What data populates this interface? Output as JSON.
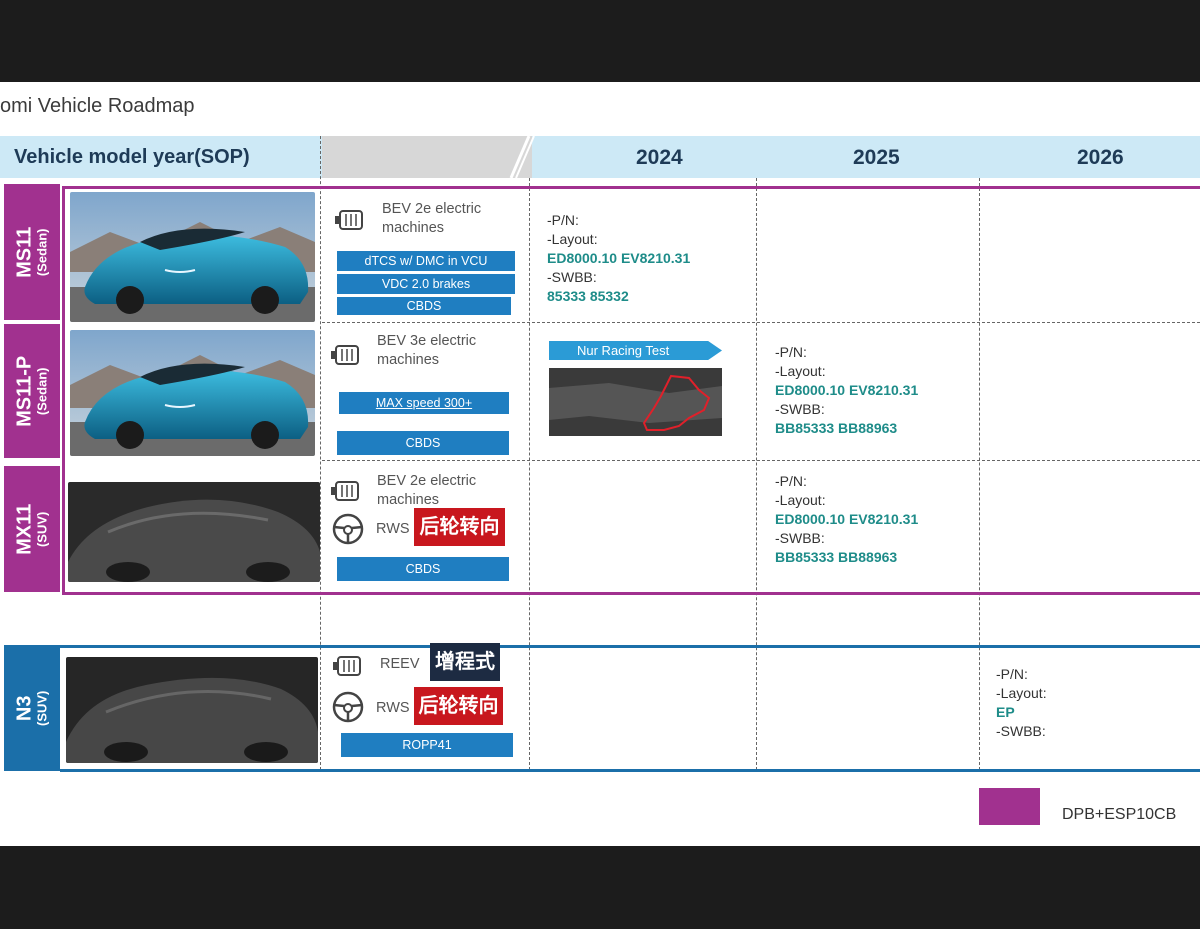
{
  "title": "omi Vehicle Roadmap",
  "header": {
    "label": "Vehicle model year(SOP)",
    "years": [
      "2024",
      "2025",
      "2026"
    ]
  },
  "rows": [
    {
      "name": "MS11",
      "type": "(Sedan)",
      "powertrain": "BEV 2e electric machines",
      "boxes": [
        "dTCS w/ DMC in VCU",
        "VDC 2.0 brakes",
        "CBDS"
      ],
      "info": {
        "pn": "-P/N:",
        "layout": "-Layout:",
        "layout_val": "ED8000.10  EV8210.31",
        "swbb": "-SWBB:",
        "swbb_val": "85333  85332"
      }
    },
    {
      "name": "MS11-P",
      "type": "(Sedan)",
      "powertrain": "BEV 3e electric machines",
      "boxes": [
        "MAX speed 300+",
        "CBDS"
      ],
      "racing": "Nur Racing Test",
      "info": {
        "pn": "-P/N:",
        "layout": "-Layout:",
        "layout_val": "ED8000.10  EV8210.31",
        "swbb": "-SWBB:",
        "swbb_val": "BB85333     BB88963"
      }
    },
    {
      "name": "MX11",
      "type": "(SUV)",
      "powertrain": "BEV 2e electric machines",
      "rws": "RWS",
      "rws_tag": "后轮转向",
      "boxes": [
        "CBDS"
      ],
      "info": {
        "pn": "-P/N:",
        "layout": "-Layout:",
        "layout_val": "ED8000.10  EV8210.31",
        "swbb": "-SWBB:",
        "swbb_val": "BB85333     BB88963"
      }
    },
    {
      "name": "N3",
      "type": "(SUV)",
      "powertrain": "REEV",
      "powertrain_tag": "增程式",
      "rws": "RWS",
      "rws_tag": "后轮转向",
      "boxes": [
        "ROPP41"
      ],
      "info": {
        "pn": "-P/N:",
        "layout": "-Layout:",
        "layout_val": "EP",
        "swbb": "-SWBB:"
      }
    }
  ],
  "legend": {
    "label": "DPB+ESP10CB",
    "color": "#a1318f"
  },
  "colors": {
    "purple": "#a1318f",
    "blue": "#1b6fa9",
    "teal": "#1e8c89",
    "header": "#cde9f6"
  }
}
